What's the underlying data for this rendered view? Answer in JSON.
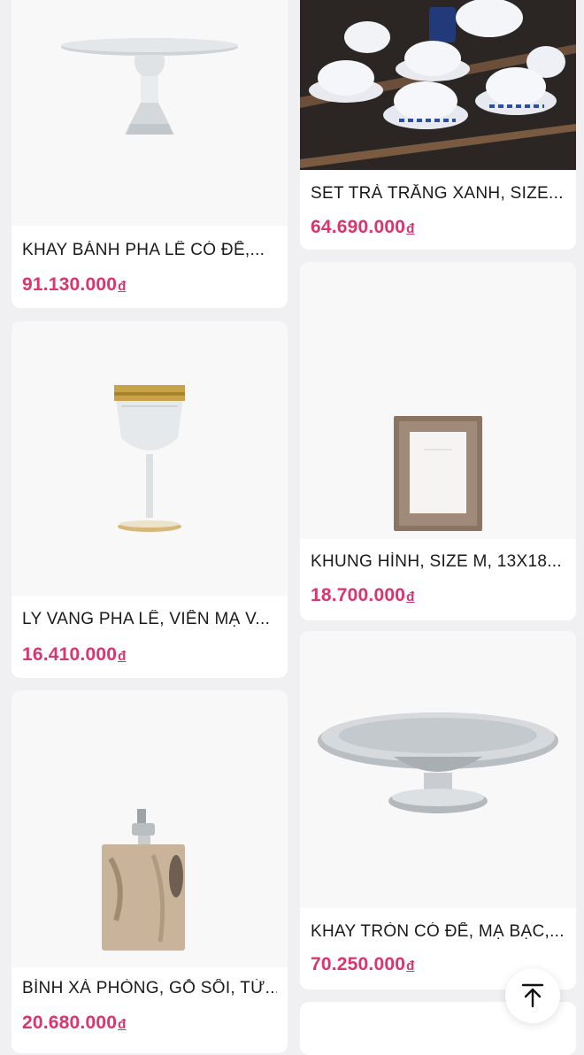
{
  "currency": "đ",
  "products": [
    {
      "name": "KHAY BÁNH PHA LÊ CÓ ĐẾ,...",
      "price": "91.130.000",
      "image": "crystal-cake-stand-image"
    },
    {
      "name": "SET TRÀ TRẮNG XANH, SIZE...",
      "price": "64.690.000",
      "image": "blue-white-tea-set-image"
    },
    {
      "name": "LY VANG PHA LÊ, VIỀN MẠ V...",
      "price": "16.410.000",
      "image": "gold-rim-wine-glass-image"
    },
    {
      "name": "KHUNG HÌNH, SIZE M, 13X18...",
      "price": "18.700.000",
      "image": "wooden-photo-frame-image"
    },
    {
      "name": "BÌNH XÀ PHÒNG, GỖ SỒI, TỪ...",
      "price": "20.680.000",
      "image": "oak-soap-dispenser-image"
    },
    {
      "name": "KHAY TRÒN CÓ ĐẾ, MẠ BẠC,...",
      "price": "70.250.000",
      "image": "silver-footed-tray-image"
    }
  ],
  "scroll_top": {
    "icon": "arrow-up-to-top-icon"
  }
}
